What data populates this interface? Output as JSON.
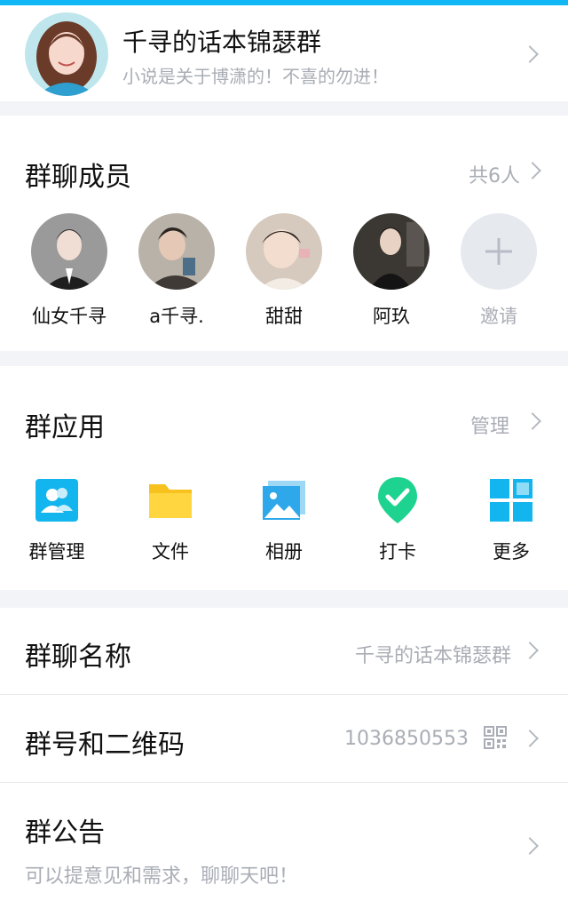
{
  "group": {
    "name": "千寻的话本锦瑟群",
    "description": "小说是关于博潇的！不喜的勿进！"
  },
  "members": {
    "title": "群聊成员",
    "count_label": "共6人",
    "list": [
      {
        "name": "仙女千寻"
      },
      {
        "name": "a千寻."
      },
      {
        "name": "甜甜"
      },
      {
        "name": "阿玖"
      }
    ],
    "invite_label": "邀请"
  },
  "apps": {
    "title": "群应用",
    "manage_label": "管理",
    "items": [
      {
        "label": "群管理",
        "icon": "group-manage-icon"
      },
      {
        "label": "文件",
        "icon": "folder-icon"
      },
      {
        "label": "相册",
        "icon": "photo-album-icon"
      },
      {
        "label": "打卡",
        "icon": "check-in-icon"
      },
      {
        "label": "更多",
        "icon": "more-grid-icon"
      }
    ]
  },
  "settings": {
    "group_name_label": "群聊名称",
    "group_name_value": "千寻的话本锦瑟群",
    "group_number_label": "群号和二维码",
    "group_number_value": "1036850553",
    "announcement_label": "群公告",
    "announcement_value": "可以提意见和需求，聊聊天吧！"
  },
  "colors": {
    "accent": "#12b7f5",
    "secondary_text": "#a9adb5",
    "background": "#f2f4f7"
  }
}
